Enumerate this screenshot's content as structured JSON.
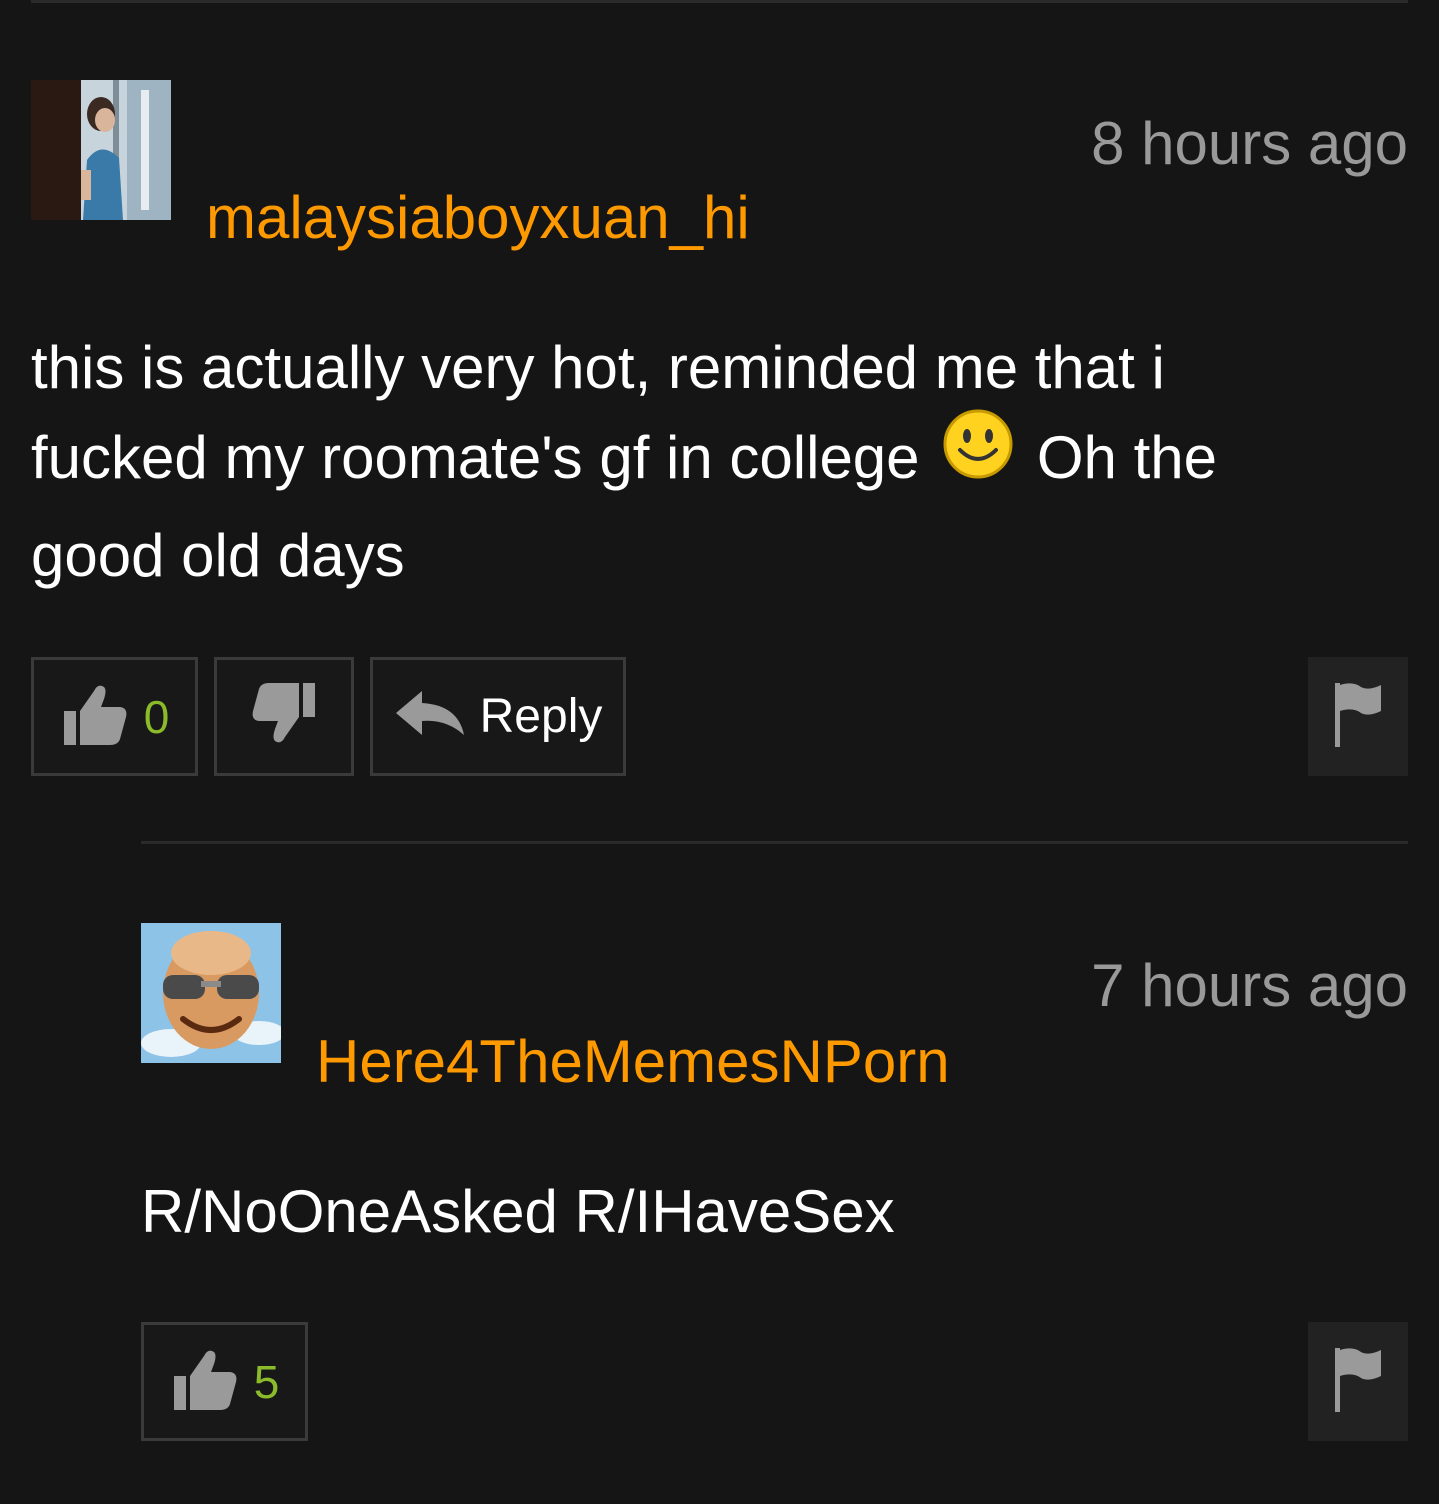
{
  "colors": {
    "background": "#151515",
    "username": "#ff9900",
    "timestamp": "#999999",
    "vote_count": "#8bbb2a",
    "button_border": "#3a3a3a",
    "icon": "#9a9a9a"
  },
  "comments": [
    {
      "username": "malaysiaboyxuan_hi",
      "timestamp": "8 hours ago",
      "body_part1": "this is actually very hot, reminded me that i fucked my roomate's gf in college",
      "body_part2": "Oh the good old days",
      "emoji": "smiley-face-icon",
      "like_count": "0",
      "reply_label": "Reply"
    },
    {
      "username": "Here4TheMemesNPorn",
      "timestamp": "7 hours ago",
      "body": "R/NoOneAsked R/IHaveSex",
      "like_count": "5"
    }
  ]
}
